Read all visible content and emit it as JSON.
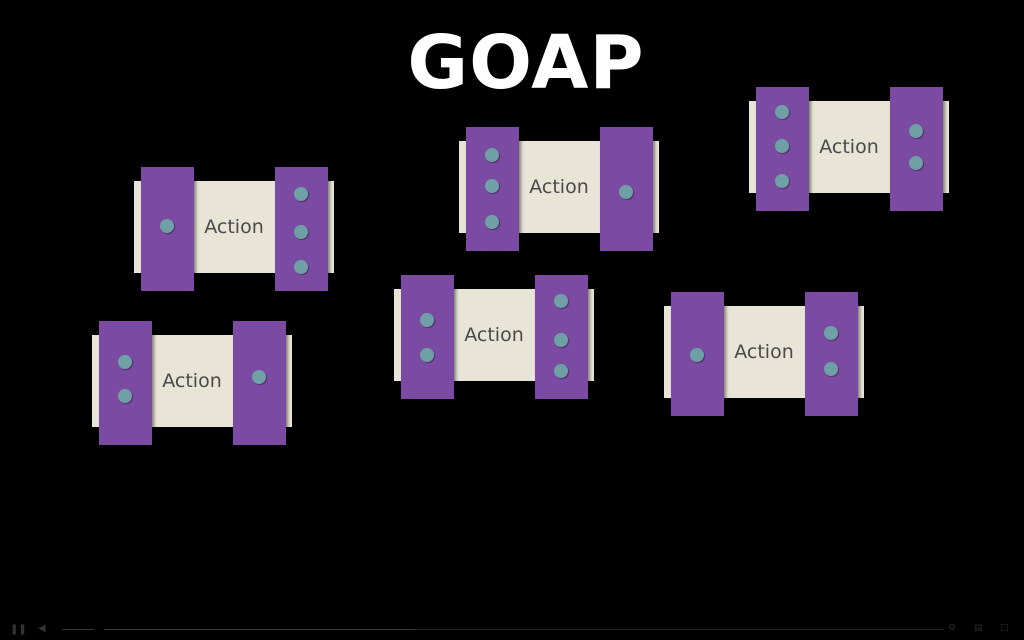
{
  "slide": {
    "title": "GOAP",
    "action_label": "Action",
    "colors": {
      "background": "#000000",
      "title": "#ffffff",
      "action_body": "#e8e4d6",
      "action_side": "#7b4aa3",
      "connector_dot": "#6fa0a6"
    },
    "actions": [
      {
        "label": "Action",
        "preconditions": 1,
        "effects": 3
      },
      {
        "label": "Action",
        "preconditions": 3,
        "effects": 1
      },
      {
        "label": "Action",
        "preconditions": 3,
        "effects": 2
      },
      {
        "label": "Action",
        "preconditions": 2,
        "effects": 1
      },
      {
        "label": "Action",
        "preconditions": 2,
        "effects": 3
      },
      {
        "label": "Action",
        "preconditions": 1,
        "effects": 2
      }
    ]
  },
  "player": {
    "play_icon": "pause-icon",
    "volume_icon": "speaker-icon",
    "progress": 0.37
  }
}
